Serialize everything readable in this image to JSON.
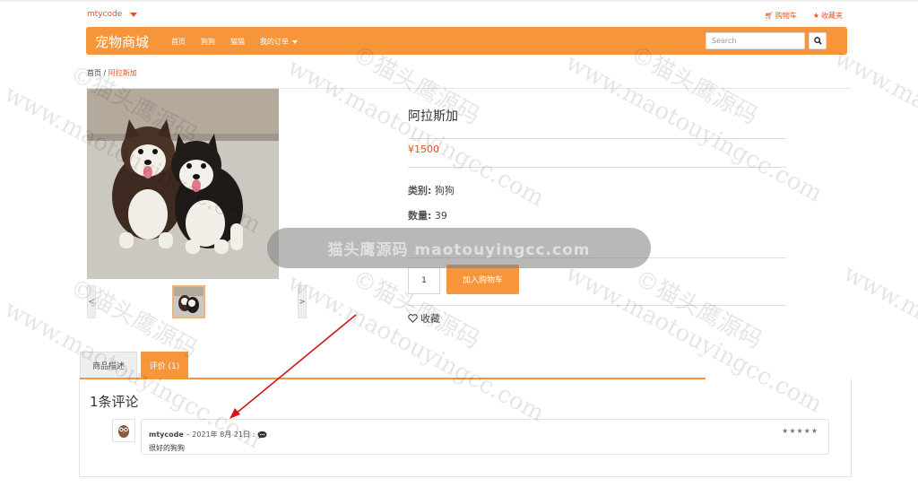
{
  "user_menu": {
    "name": "mtycode"
  },
  "top_links": {
    "cart": "购物车",
    "favorites": "收藏夹"
  },
  "navbar": {
    "brand": "宠物商城",
    "items": [
      "首页",
      "狗狗",
      "猫猫",
      "我的订单"
    ],
    "search_placeholder": "Search"
  },
  "breadcrumb": {
    "home": "首页",
    "separator": "/",
    "current": "阿拉斯加"
  },
  "product": {
    "title": "阿拉斯加",
    "price": "¥1500",
    "category_label": "类别:",
    "category_value": "狗狗",
    "stock_label": "数量:",
    "stock_value": "39",
    "quantity": "1",
    "add_to_cart": "加入购物车",
    "favorite": "收藏"
  },
  "gallery": {
    "prev": "<",
    "next": ">"
  },
  "tabs": {
    "description": "商品描述",
    "reviews": "评价 (1)"
  },
  "reviews": {
    "count_title": "1条评论",
    "items": [
      {
        "author": "mtycode",
        "date": "– 2021年 8月 21日 :",
        "text": "很好的狗狗",
        "stars": "★★★★★",
        "rating": 5
      }
    ]
  },
  "watermark": {
    "band_text": "猫头鹰源码 maotouyingcc.com",
    "tiles": [
      "www.maotouyingcc.com",
      "©猫头鹰源码"
    ]
  },
  "colors": {
    "accent": "#f7953b",
    "link": "#e8531f",
    "annotation": "#d0161b"
  }
}
